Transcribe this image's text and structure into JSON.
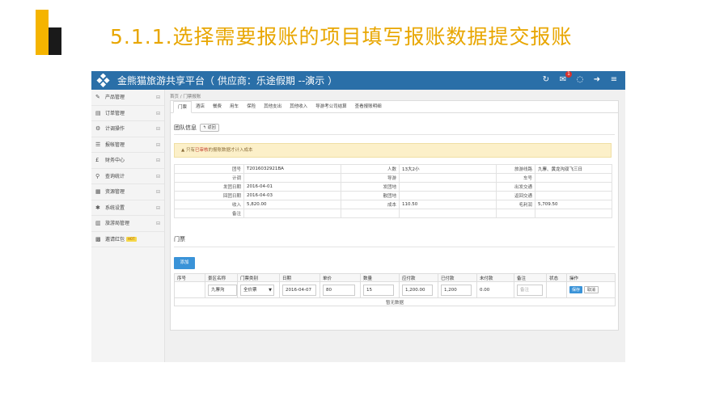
{
  "slide": {
    "title": "5.1.1.选择需要报账的项目填写报账数据提交报账"
  },
  "app": {
    "platform_name": "金熊猫旅游共享平台（ 供应商：乐途假期 --演示 ）",
    "topbar_badge": "1"
  },
  "sidebar": {
    "items": [
      {
        "label": "产品管理",
        "icon": "edit-icon",
        "glyph": "✎"
      },
      {
        "label": "订单管理",
        "icon": "list-icon",
        "glyph": "▤"
      },
      {
        "label": "计调操作",
        "icon": "dispatch-icon",
        "glyph": "⚙"
      },
      {
        "label": "报帐管理",
        "icon": "report-icon",
        "glyph": "☰"
      },
      {
        "label": "财务中心",
        "icon": "yuan-icon",
        "glyph": "£"
      },
      {
        "label": "查询统计",
        "icon": "search-icon",
        "glyph": "⚲"
      },
      {
        "label": "资源管理",
        "icon": "resource-icon",
        "glyph": "▦"
      },
      {
        "label": "系统设置",
        "icon": "gear-icon",
        "glyph": "✱"
      },
      {
        "label": "旅游局管理",
        "icon": "building-icon",
        "glyph": "▥"
      },
      {
        "label": "邀请红包",
        "icon": "gift-icon",
        "glyph": "▩",
        "hot": "HOT"
      }
    ]
  },
  "breadcrumb": "首页 / 门票报账",
  "tabs": [
    "门票",
    "酒店",
    "餐费",
    "用车",
    "保险",
    "其他支出",
    "其他收入",
    "导游考公司结算",
    "查看报账明细"
  ],
  "team_info": {
    "title": "团队信息",
    "back_label": "返回"
  },
  "alert": {
    "text_before": "只有",
    "highlight": "已审核",
    "text_after": "的报账数据才计入成本"
  },
  "info_rows": [
    [
      "团号",
      "T2016032921BA",
      "人数",
      "13大2小",
      "旅游线路",
      "九寨、黄龙沟双飞三日"
    ],
    [
      "计调",
      "",
      "导游",
      "",
      "车号",
      ""
    ],
    [
      "发团日期",
      "2016-04-01",
      "发团地",
      "",
      "出发交通",
      ""
    ],
    [
      "回团日期",
      "2016-04-03",
      "散团地",
      "",
      "返回交通",
      ""
    ],
    [
      "收入",
      "5,820.00",
      "成本",
      "110.50",
      "毛利润",
      "5,709.50"
    ],
    [
      "备注",
      "",
      "",
      "",
      "",
      ""
    ]
  ],
  "tickets": {
    "title": "门票",
    "add_label": "添加",
    "headers": [
      "序号",
      "景区名称",
      "门票类别",
      "日期",
      "单价",
      "数量",
      "应付款",
      "已付款",
      "未付款",
      "备注",
      "状态",
      "操作"
    ],
    "row": {
      "spot": "九寨沟",
      "category": "全价票",
      "date": "2016-04-07",
      "price": "80",
      "qty": "15",
      "payable": "1,200.00",
      "paid": "1,200",
      "unpaid": "0.00",
      "remark_placeholder": "备注",
      "save": "保存",
      "cancel": "取消"
    },
    "no_data": "暂无数据"
  }
}
